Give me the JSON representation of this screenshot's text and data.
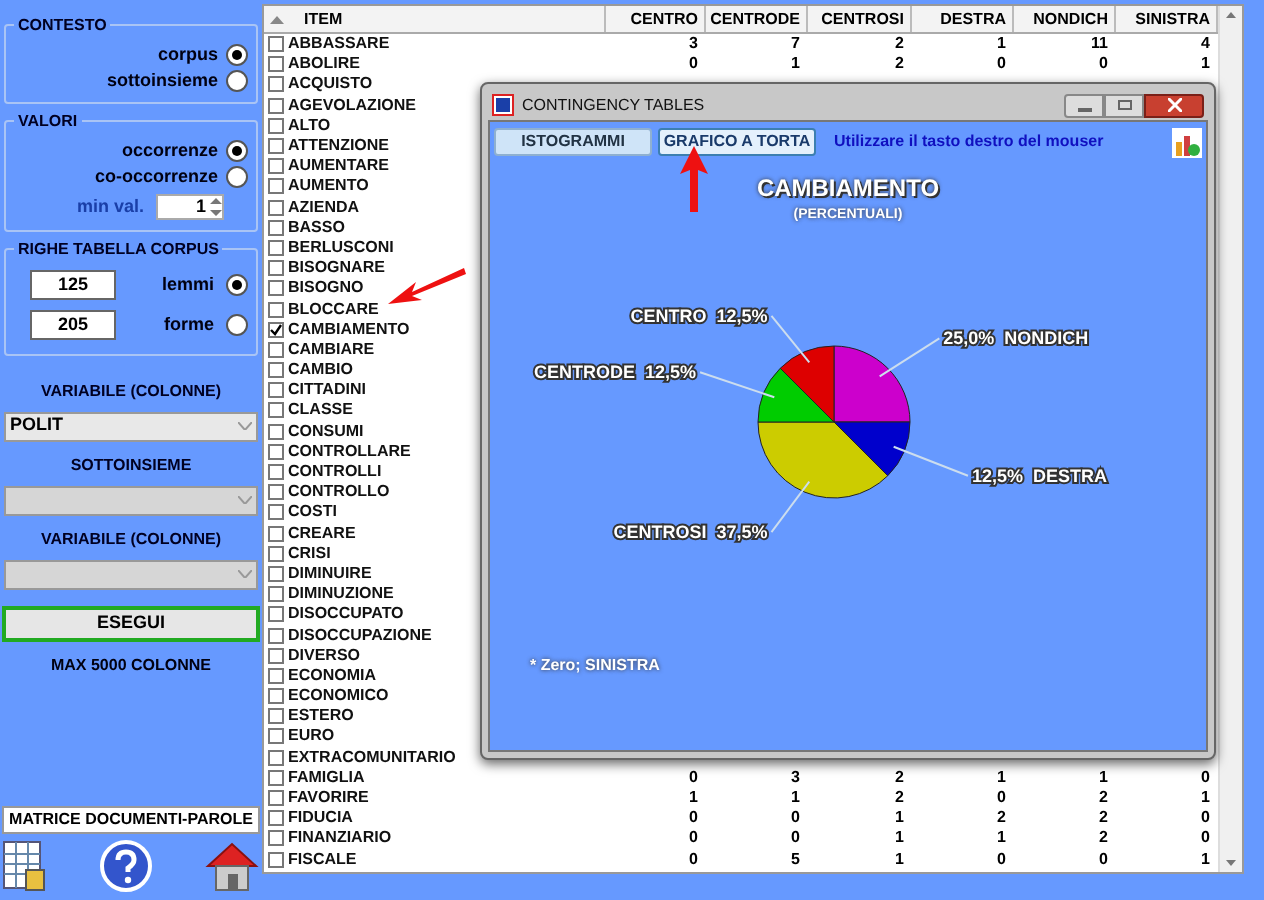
{
  "contesto": {
    "title": "CONTESTO",
    "options": [
      {
        "label": "corpus",
        "selected": true
      },
      {
        "label": "sottoinsieme",
        "selected": false
      }
    ]
  },
  "valori": {
    "title": "VALORI",
    "options": [
      {
        "label": "occorrenze",
        "selected": true
      },
      {
        "label": "co-occorrenze",
        "selected": false
      }
    ],
    "min_label": "min val.",
    "min_value": "1"
  },
  "righe": {
    "title": "RIGHE TABELLA CORPUS",
    "options": [
      {
        "value": "125",
        "label": "lemmi",
        "selected": true
      },
      {
        "value": "205",
        "label": "forme",
        "selected": false
      }
    ]
  },
  "selects": [
    {
      "label": "VARIABILE (COLONNE)",
      "value": "POLIT",
      "disabled": false
    },
    {
      "label": "SOTTOINSIEME",
      "disabled": true
    },
    {
      "label": "VARIABILE (COLONNE)",
      "disabled": true
    }
  ],
  "run_button": "ESEGUI",
  "max_note": "MAX 5000 COLONNE",
  "matrix_label": "MATRICE DOCUMENTI-PAROLE",
  "table": {
    "columns": [
      "ITEM",
      "CENTRO",
      "CENTRODE",
      "CENTROSI",
      "DESTRA",
      "NONDICH",
      "SINISTRA"
    ],
    "rows": [
      {
        "item": "ABBASSARE",
        "checked": false,
        "values": [
          "3",
          "7",
          "2",
          "1",
          "11",
          "4"
        ]
      },
      {
        "item": "ABOLIRE",
        "checked": false,
        "values": [
          "0",
          "1",
          "2",
          "0",
          "0",
          "1"
        ]
      },
      {
        "item": "ACQUISTO",
        "checked": false
      },
      {
        "item": "AGEVOLAZIONE",
        "checked": false
      },
      {
        "item": "ALTO",
        "checked": false
      },
      {
        "item": "ATTENZIONE",
        "checked": false
      },
      {
        "item": "AUMENTARE",
        "checked": false
      },
      {
        "item": "AUMENTO",
        "checked": false
      },
      {
        "item": "AZIENDA",
        "checked": false
      },
      {
        "item": "BASSO",
        "checked": false
      },
      {
        "item": "BERLUSCONI",
        "checked": false
      },
      {
        "item": "BISOGNARE",
        "checked": false
      },
      {
        "item": "BISOGNO",
        "checked": false
      },
      {
        "item": "BLOCCARE",
        "checked": false
      },
      {
        "item": "CAMBIAMENTO",
        "checked": true
      },
      {
        "item": "CAMBIARE",
        "checked": false
      },
      {
        "item": "CAMBIO",
        "checked": false
      },
      {
        "item": "CITTADINI",
        "checked": false
      },
      {
        "item": "CLASSE",
        "checked": false
      },
      {
        "item": "CONSUMI",
        "checked": false
      },
      {
        "item": "CONTROLLARE",
        "checked": false
      },
      {
        "item": "CONTROLLI",
        "checked": false
      },
      {
        "item": "CONTROLLO",
        "checked": false
      },
      {
        "item": "COSTI",
        "checked": false
      },
      {
        "item": "CREARE",
        "checked": false
      },
      {
        "item": "CRISI",
        "checked": false
      },
      {
        "item": "DIMINUIRE",
        "checked": false
      },
      {
        "item": "DIMINUZIONE",
        "checked": false
      },
      {
        "item": "DISOCCUPATO",
        "checked": false
      },
      {
        "item": "DISOCCUPAZIONE",
        "checked": false
      },
      {
        "item": "DIVERSO",
        "checked": false
      },
      {
        "item": "ECONOMIA",
        "checked": false
      },
      {
        "item": "ECONOMICO",
        "checked": false
      },
      {
        "item": "ESTERO",
        "checked": false
      },
      {
        "item": "EURO",
        "checked": false
      },
      {
        "item": "EXTRACOMUNITARIO",
        "checked": false
      },
      {
        "item": "FAMIGLIA",
        "checked": false,
        "values": [
          "0",
          "3",
          "2",
          "1",
          "1",
          "0"
        ]
      },
      {
        "item": "FAVORIRE",
        "checked": false,
        "values": [
          "1",
          "1",
          "2",
          "0",
          "2",
          "1"
        ]
      },
      {
        "item": "FIDUCIA",
        "checked": false,
        "values": [
          "0",
          "0",
          "1",
          "2",
          "2",
          "0"
        ]
      },
      {
        "item": "FINANZIARIO",
        "checked": false,
        "values": [
          "0",
          "0",
          "1",
          "1",
          "2",
          "0"
        ]
      },
      {
        "item": "FISCALE",
        "checked": false,
        "values": [
          "0",
          "5",
          "1",
          "0",
          "0",
          "1"
        ]
      }
    ]
  },
  "dialog": {
    "title": "CONTINGENCY TABLES",
    "tabs": [
      {
        "label": "ISTOGRAMMI",
        "selected": false
      },
      {
        "label": "GRAFICO A TORTA",
        "selected": true
      }
    ],
    "hint": "Utilizzare il tasto destro del mouser",
    "subtitle": "(PERCENTUALI)",
    "note": "* Zero; SINISTRA",
    "chart_data": {
      "type": "pie",
      "title": "CAMBIAMENTO",
      "categories": [
        "NONDICH",
        "DESTRA",
        "CENTROSI",
        "CENTRODE",
        "CENTRO"
      ],
      "series": [
        {
          "values": [
            25.0,
            12.5,
            37.5,
            12.5,
            12.5
          ],
          "colors": [
            "#cc00cc",
            "#0000cc",
            "#cccc00",
            "#00cc00",
            "#dd0000"
          ]
        }
      ],
      "value_labels": [
        "25,0%",
        "12,5%",
        "37,5%",
        "12,5%",
        "12,5%"
      ]
    }
  }
}
